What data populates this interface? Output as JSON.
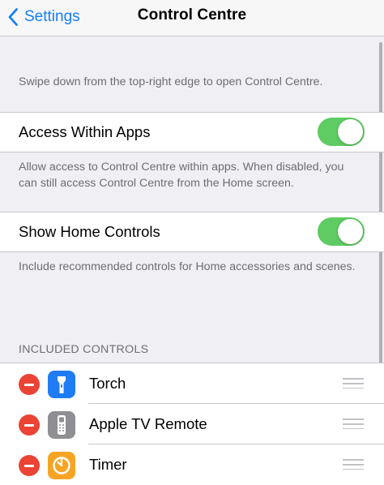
{
  "navbar": {
    "back_label": "Settings",
    "title": "Control Centre"
  },
  "intro_note": "Swipe down from the top-right edge to open Control Centre.",
  "access_within_apps": {
    "label": "Access Within Apps",
    "enabled": true,
    "note": "Allow access to Control Centre within apps. When disabled, you can still access Control Centre from the Home screen."
  },
  "show_home_controls": {
    "label": "Show Home Controls",
    "enabled": true,
    "note": "Include recommended controls for Home accessories and scenes."
  },
  "included_controls": {
    "header": "INCLUDED CONTROLS",
    "items": [
      {
        "label": "Torch",
        "icon": "torch-icon",
        "icon_color": "#1f7cf5"
      },
      {
        "label": "Apple TV Remote",
        "icon": "apple-tv-remote-icon",
        "icon_color": "#8e8e93"
      },
      {
        "label": "Timer",
        "icon": "timer-icon",
        "icon_color": "#f7a425"
      }
    ]
  },
  "colors": {
    "accent": "#147efb",
    "toggle_on": "#5fcb63",
    "remove": "#eb4334"
  }
}
